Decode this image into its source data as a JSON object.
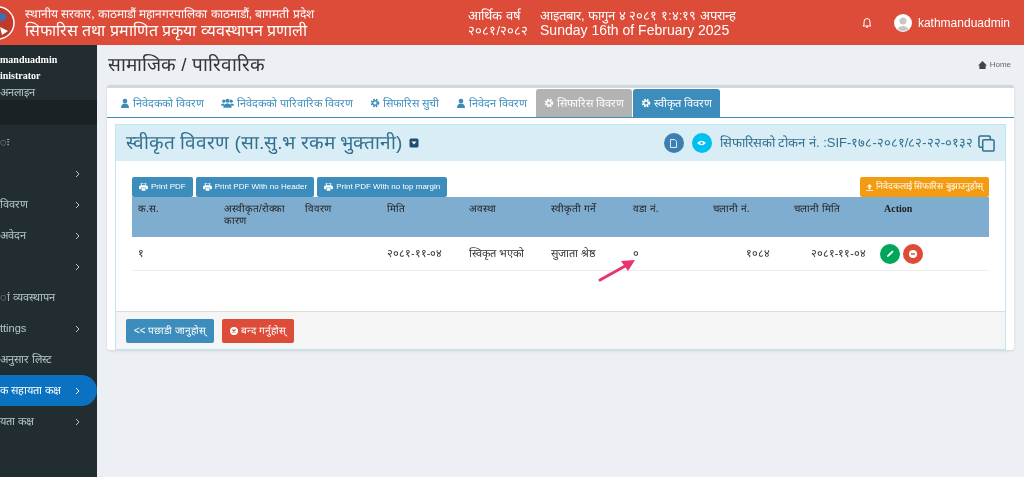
{
  "header": {
    "line_1": "स्थानीय सरकार, काठमाडौं महानगरपालिका काठमाडौं, बागमती प्रदेश",
    "line_2": "सिफारिस तथा प्रमाणित प्रकृया व्यवस्थापन प्रणाली",
    "fiscal_label": "आर्थिक वर्ष",
    "fiscal_year": "२०८१/२०८२",
    "nepali_date": "आइतबार, फागुन ४ २०८१ १:४:१९ अपरान्ह",
    "english_date": "Sunday 16th of February 2025",
    "user": "kathmanduadmin"
  },
  "sidebar": {
    "user_name": "manduadmin",
    "role": "inistrator",
    "status": "अनलाइन",
    "items": [
      {
        "label": "ः",
        "has_children": false,
        "selected": false
      },
      {
        "has_children": true,
        "selected": false
      },
      {
        "label": "विवरण",
        "has_children": true,
        "selected": false
      },
      {
        "label": "अवेदन",
        "has_children": true,
        "selected": false
      },
      {
        "has_children": true,
        "selected": false
      },
      {
        "label": "ां व्यवस्थापन",
        "has_children": false,
        "selected": false
      },
      {
        "label": "ttings",
        "has_children": true,
        "selected": false
      },
      {
        "label": "अनुसार लिस्ट",
        "has_children": false,
        "selected": false
      },
      {
        "label": "क सहायता कक्ष",
        "has_children": true,
        "selected": true
      },
      {
        "label": "यता कक्ष",
        "has_children": true,
        "selected": false
      }
    ]
  },
  "page": {
    "title": "सामाजिक / पारिवारिक",
    "breadcrumb": "Home"
  },
  "tabs": [
    {
      "label": "निवेदकको विवरण",
      "kind": "person",
      "selected": false,
      "disabled": false
    },
    {
      "label": "निवेदकको पारिवारिक विवरण",
      "kind": "family",
      "selected": false,
      "disabled": false
    },
    {
      "label": "सिफारिस सुची",
      "kind": "settings",
      "selected": false,
      "disabled": false
    },
    {
      "label": "निवेदन विवरण",
      "kind": "person",
      "selected": false,
      "disabled": false
    },
    {
      "label": "सिफारिस विवरण",
      "kind": "settings",
      "selected": false,
      "disabled": true
    },
    {
      "label": "स्वीकृत विवरण",
      "kind": "settings",
      "selected": true,
      "disabled": false
    }
  ],
  "panel": {
    "title": "स्वीकृत विवरण (सा.सु.भ रकम भुक्तानी)",
    "token": "सिफारिसको टोकन नं. :SIF-१७८-२०८१/८२-२२-०१३२"
  },
  "print_buttons": [
    "Print PDF",
    "Print PDF With no Header",
    "Print PDF With no top margin"
  ],
  "notify_button": "निवेदकलाई सिफारिस बुझाउनुहोस्",
  "table": {
    "columns": [
      "क.स.",
      "अस्वीकृत/रोक्का कारण",
      "विवरण",
      "मिति",
      "अवस्था",
      "स्वीकृती गर्ने",
      "वडा नं.",
      "चलानी नं.",
      "चलानी मिति",
      "Action"
    ],
    "rows": [
      [
        "१",
        "",
        "",
        "२०८१-११-०४",
        "स्विकृत भएको",
        "सुजाता श्रेष्ठ",
        "०",
        "१०८४",
        "२०८१-११-०४"
      ]
    ]
  },
  "footer_buttons": [
    {
      "label": "<< पछाडी जानुहोस्",
      "kind": "back"
    },
    {
      "label": "बन्द गर्नुहोस्",
      "kind": "close"
    }
  ]
}
